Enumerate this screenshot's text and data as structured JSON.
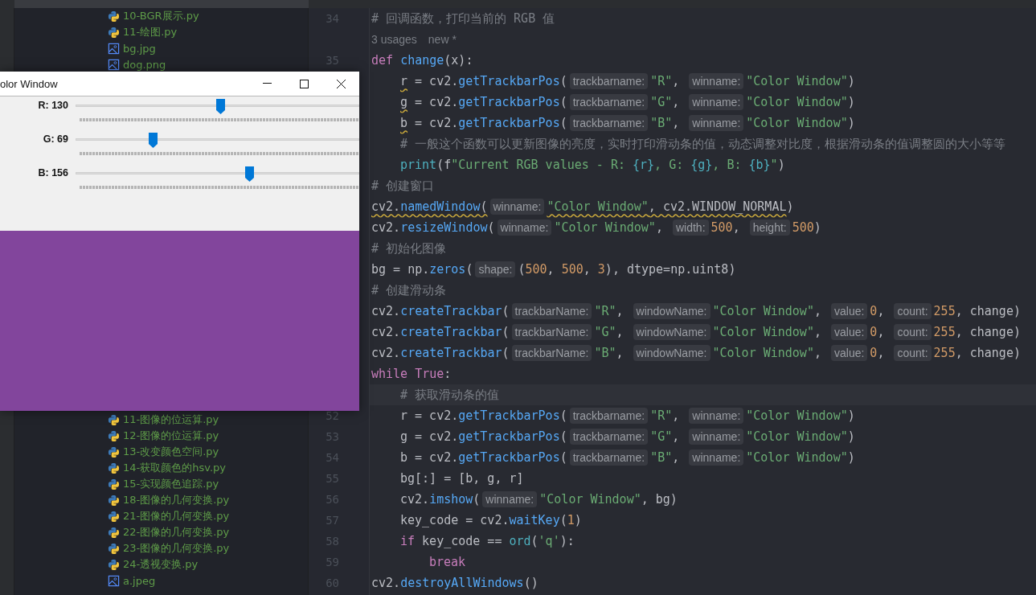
{
  "project_tree": {
    "top_items": [
      {
        "kind": "python",
        "name": "10-BGR展示.py"
      },
      {
        "kind": "python",
        "name": "11-绘图.py"
      },
      {
        "kind": "image",
        "name": "bg.jpg"
      },
      {
        "kind": "image",
        "name": "dog.png"
      }
    ],
    "bottom_items": [
      {
        "kind": "python",
        "name": "11-图像的位运算.py"
      },
      {
        "kind": "python",
        "name": "12-图像的位运算.py"
      },
      {
        "kind": "python",
        "name": "13-改变颜色空间.py"
      },
      {
        "kind": "python",
        "name": "14-获取颜色的hsv.py"
      },
      {
        "kind": "python",
        "name": "15-实现颜色追踪.py"
      },
      {
        "kind": "python",
        "name": "18-图像的几何变换.py"
      },
      {
        "kind": "python",
        "name": "21-图像的几何变换.py"
      },
      {
        "kind": "python",
        "name": "22-图像的几何变换.py"
      },
      {
        "kind": "python",
        "name": "23-图像的几何变换.py"
      },
      {
        "kind": "python",
        "name": "24-透视变换.py"
      },
      {
        "kind": "image",
        "name": "a.jpeg"
      }
    ]
  },
  "editor": {
    "lines": [
      {
        "number": "34",
        "tokens": [
          {
            "kind": "comment",
            "text": "# 回调函数，打印当前的 RGB 值"
          }
        ]
      },
      {
        "kind": "usages",
        "texts": [
          "3 usages",
          "new *"
        ]
      },
      {
        "number": "35",
        "tokens": [
          {
            "kind": "keyword",
            "text": "def "
          },
          {
            "kind": "function",
            "text": "change"
          },
          {
            "kind": "plain",
            "text": "(x):"
          }
        ],
        "children": [
          {
            "tokens": [
              {
                "kind": "plain",
                "text": "r",
                "warning": true
              },
              {
                "kind": "plain",
                "text": " = cv2."
              },
              {
                "kind": "function",
                "text": "getTrackbarPos"
              },
              {
                "kind": "plain",
                "text": "("
              },
              {
                "kind": "hint",
                "text": "trackbarname:"
              },
              {
                "kind": "string",
                "text": "\"R\""
              },
              {
                "kind": "plain",
                "text": ", "
              },
              {
                "kind": "hint",
                "text": "winname:"
              },
              {
                "kind": "string",
                "text": "\"Color Window\""
              },
              {
                "kind": "plain",
                "text": ")"
              }
            ]
          },
          {
            "tokens": [
              {
                "kind": "plain",
                "text": "g",
                "warning": true
              },
              {
                "kind": "plain",
                "text": " = cv2."
              },
              {
                "kind": "function",
                "text": "getTrackbarPos"
              },
              {
                "kind": "plain",
                "text": "("
              },
              {
                "kind": "hint",
                "text": "trackbarname:"
              },
              {
                "kind": "string",
                "text": "\"G\""
              },
              {
                "kind": "plain",
                "text": ", "
              },
              {
                "kind": "hint",
                "text": "winname:"
              },
              {
                "kind": "string",
                "text": "\"Color Window\""
              },
              {
                "kind": "plain",
                "text": ")"
              }
            ]
          },
          {
            "tokens": [
              {
                "kind": "plain",
                "text": "b",
                "warning": true
              },
              {
                "kind": "plain",
                "text": " = cv2."
              },
              {
                "kind": "function",
                "text": "getTrackbarPos"
              },
              {
                "kind": "plain",
                "text": "("
              },
              {
                "kind": "hint",
                "text": "trackbarname:"
              },
              {
                "kind": "string",
                "text": "\"B\""
              },
              {
                "kind": "plain",
                "text": ", "
              },
              {
                "kind": "hint",
                "text": "winname:"
              },
              {
                "kind": "string",
                "text": "\"Color Window\""
              },
              {
                "kind": "plain",
                "text": ")"
              }
            ]
          },
          {
            "tokens": [
              {
                "kind": "comment",
                "text": "# 一般这个函数可以更新图像的亮度，实时打印滑动条的值，动态调整对比度，根据滑动条的值调整圆的大小等等"
              }
            ]
          },
          {
            "tokens": [
              {
                "kind": "builtin",
                "text": "print"
              },
              {
                "kind": "plain",
                "text": "(f"
              },
              {
                "kind": "string",
                "text": "\"Current RGB values - R: "
              },
              {
                "kind": "builtin",
                "text": "{r}"
              },
              {
                "kind": "string",
                "text": ", G: "
              },
              {
                "kind": "builtin",
                "text": "{g}"
              },
              {
                "kind": "string",
                "text": ", B: "
              },
              {
                "kind": "builtin",
                "text": "{b}"
              },
              {
                "kind": "string",
                "text": "\""
              },
              {
                "kind": "plain",
                "text": ")"
              }
            ]
          }
        ]
      },
      {
        "tokens": [
          {
            "kind": "comment",
            "text": "# 创建窗口"
          }
        ]
      },
      {
        "tokens": [
          {
            "kind": "plain",
            "text": "cv2.",
            "warning": true
          },
          {
            "kind": "function",
            "text": "namedWindow",
            "warning": true
          },
          {
            "kind": "plain",
            "text": "(",
            "warning": true
          },
          {
            "kind": "hint",
            "text": "winname:"
          },
          {
            "kind": "string",
            "text": "\"Color Window\"",
            "warning": true
          },
          {
            "kind": "plain",
            "text": ", cv2.WINDOW_NORMAL",
            "warning": true
          },
          {
            "kind": "plain",
            "text": ")"
          }
        ]
      },
      {
        "tokens": [
          {
            "kind": "plain",
            "text": "cv2."
          },
          {
            "kind": "function",
            "text": "resizeWindow"
          },
          {
            "kind": "plain",
            "text": "("
          },
          {
            "kind": "hint",
            "text": "winname:"
          },
          {
            "kind": "string",
            "text": "\"Color Window\""
          },
          {
            "kind": "plain",
            "text": ", "
          },
          {
            "kind": "hint",
            "text": "width:"
          },
          {
            "kind": "number",
            "text": "500"
          },
          {
            "kind": "plain",
            "text": ", "
          },
          {
            "kind": "hint",
            "text": "height:"
          },
          {
            "kind": "number",
            "text": "500"
          },
          {
            "kind": "plain",
            "text": ")"
          }
        ]
      },
      {
        "tokens": [
          {
            "kind": "comment",
            "text": "# 初始化图像"
          }
        ]
      },
      {
        "tokens": [
          {
            "kind": "plain",
            "text": "bg = np."
          },
          {
            "kind": "function",
            "text": "zeros"
          },
          {
            "kind": "plain",
            "text": "("
          },
          {
            "kind": "hint",
            "text": "shape:"
          },
          {
            "kind": "plain",
            "text": "("
          },
          {
            "kind": "number",
            "text": "500"
          },
          {
            "kind": "plain",
            "text": ", "
          },
          {
            "kind": "number",
            "text": "500"
          },
          {
            "kind": "plain",
            "text": ", "
          },
          {
            "kind": "number",
            "text": "3"
          },
          {
            "kind": "plain",
            "text": "), dtype=np.uint8)"
          }
        ]
      },
      {
        "tokens": [
          {
            "kind": "comment",
            "text": "# 创建滑动条"
          }
        ]
      },
      {
        "tokens": [
          {
            "kind": "plain",
            "text": "cv2."
          },
          {
            "kind": "function",
            "text": "createTrackbar"
          },
          {
            "kind": "plain",
            "text": "("
          },
          {
            "kind": "hint",
            "text": "trackbarName:"
          },
          {
            "kind": "string",
            "text": "\"R\""
          },
          {
            "kind": "plain",
            "text": ", "
          },
          {
            "kind": "hint",
            "text": "windowName:"
          },
          {
            "kind": "string",
            "text": "\"Color Window\""
          },
          {
            "kind": "plain",
            "text": ", "
          },
          {
            "kind": "hint",
            "text": "value:"
          },
          {
            "kind": "number",
            "text": "0"
          },
          {
            "kind": "plain",
            "text": ", "
          },
          {
            "kind": "hint",
            "text": "count:"
          },
          {
            "kind": "number",
            "text": "255"
          },
          {
            "kind": "plain",
            "text": ", change)"
          }
        ]
      },
      {
        "tokens": [
          {
            "kind": "plain",
            "text": "cv2."
          },
          {
            "kind": "function",
            "text": "createTrackbar"
          },
          {
            "kind": "plain",
            "text": "("
          },
          {
            "kind": "hint",
            "text": "trackbarName:"
          },
          {
            "kind": "string",
            "text": "\"G\""
          },
          {
            "kind": "plain",
            "text": ", "
          },
          {
            "kind": "hint",
            "text": "windowName:"
          },
          {
            "kind": "string",
            "text": "\"Color Window\""
          },
          {
            "kind": "plain",
            "text": ", "
          },
          {
            "kind": "hint",
            "text": "value:"
          },
          {
            "kind": "number",
            "text": "0"
          },
          {
            "kind": "plain",
            "text": ", "
          },
          {
            "kind": "hint",
            "text": "count:"
          },
          {
            "kind": "number",
            "text": "255"
          },
          {
            "kind": "plain",
            "text": ", change)"
          }
        ]
      },
      {
        "tokens": [
          {
            "kind": "plain",
            "text": "cv2."
          },
          {
            "kind": "function",
            "text": "createTrackbar"
          },
          {
            "kind": "plain",
            "text": "("
          },
          {
            "kind": "hint",
            "text": "trackbarName:"
          },
          {
            "kind": "string",
            "text": "\"B\""
          },
          {
            "kind": "plain",
            "text": ", "
          },
          {
            "kind": "hint",
            "text": "windowName:"
          },
          {
            "kind": "string",
            "text": "\"Color Window\""
          },
          {
            "kind": "plain",
            "text": ", "
          },
          {
            "kind": "hint",
            "text": "value:"
          },
          {
            "kind": "number",
            "text": "0"
          },
          {
            "kind": "plain",
            "text": ", "
          },
          {
            "kind": "hint",
            "text": "count:"
          },
          {
            "kind": "number",
            "text": "255"
          },
          {
            "kind": "plain",
            "text": ", change)"
          }
        ]
      },
      {
        "tokens": [
          {
            "kind": "keyword",
            "text": "while "
          },
          {
            "kind": "keyword",
            "text": "True"
          },
          {
            "kind": "plain",
            "text": ":"
          }
        ],
        "children": [
          {
            "current": true,
            "tokens": [
              {
                "kind": "comment",
                "text": "# 获取滑动条的值"
              }
            ]
          },
          {
            "number": "52",
            "tokens": [
              {
                "kind": "plain",
                "text": "r = cv2."
              },
              {
                "kind": "function",
                "text": "getTrackbarPos"
              },
              {
                "kind": "plain",
                "text": "("
              },
              {
                "kind": "hint",
                "text": "trackbarname:"
              },
              {
                "kind": "string",
                "text": "\"R\""
              },
              {
                "kind": "plain",
                "text": ", "
              },
              {
                "kind": "hint",
                "text": "winname:"
              },
              {
                "kind": "string",
                "text": "\"Color Window\""
              },
              {
                "kind": "plain",
                "text": ")"
              }
            ]
          },
          {
            "number": "53",
            "tokens": [
              {
                "kind": "plain",
                "text": "g = cv2."
              },
              {
                "kind": "function",
                "text": "getTrackbarPos"
              },
              {
                "kind": "plain",
                "text": "("
              },
              {
                "kind": "hint",
                "text": "trackbarname:"
              },
              {
                "kind": "string",
                "text": "\"G\""
              },
              {
                "kind": "plain",
                "text": ", "
              },
              {
                "kind": "hint",
                "text": "winname:"
              },
              {
                "kind": "string",
                "text": "\"Color Window\""
              },
              {
                "kind": "plain",
                "text": ")"
              }
            ]
          },
          {
            "number": "54",
            "tokens": [
              {
                "kind": "plain",
                "text": "b = cv2."
              },
              {
                "kind": "function",
                "text": "getTrackbarPos"
              },
              {
                "kind": "plain",
                "text": "("
              },
              {
                "kind": "hint",
                "text": "trackbarname:"
              },
              {
                "kind": "string",
                "text": "\"B\""
              },
              {
                "kind": "plain",
                "text": ", "
              },
              {
                "kind": "hint",
                "text": "winname:"
              },
              {
                "kind": "string",
                "text": "\"Color Window\""
              },
              {
                "kind": "plain",
                "text": ")"
              }
            ]
          },
          {
            "number": "55",
            "tokens": [
              {
                "kind": "plain",
                "text": "bg[:] = [b, g, r]"
              }
            ]
          },
          {
            "number": "56",
            "tokens": [
              {
                "kind": "plain",
                "text": "cv2."
              },
              {
                "kind": "function",
                "text": "imshow"
              },
              {
                "kind": "plain",
                "text": "("
              },
              {
                "kind": "hint",
                "text": "winname:"
              },
              {
                "kind": "string",
                "text": "\"Color Window\""
              },
              {
                "kind": "plain",
                "text": ", bg)"
              }
            ]
          },
          {
            "number": "57",
            "tokens": [
              {
                "kind": "plain",
                "text": "key_code = cv2."
              },
              {
                "kind": "function",
                "text": "waitKey"
              },
              {
                "kind": "plain",
                "text": "("
              },
              {
                "kind": "number",
                "text": "1"
              },
              {
                "kind": "plain",
                "text": ")"
              }
            ]
          },
          {
            "number": "58",
            "tokens": [
              {
                "kind": "keyword",
                "text": "if"
              },
              {
                "kind": "plain",
                "text": " key_code == "
              },
              {
                "kind": "builtin",
                "text": "ord"
              },
              {
                "kind": "plain",
                "text": "("
              },
              {
                "kind": "string",
                "text": "'q'"
              },
              {
                "kind": "plain",
                "text": "):"
              }
            ],
            "children": [
              {
                "number": "59",
                "tokens": [
                  {
                    "kind": "keyword",
                    "text": "break"
                  }
                ]
              }
            ]
          }
        ]
      },
      {
        "number": "60",
        "tokens": [
          {
            "kind": "plain",
            "text": "cv2."
          },
          {
            "kind": "function",
            "text": "destroyAllWindows"
          },
          {
            "kind": "plain",
            "text": "()"
          }
        ]
      }
    ]
  },
  "preview_window": {
    "title": "olor Window",
    "trackbars": [
      {
        "label": "R: 130",
        "level": 0.5098
      },
      {
        "label": "G: 69",
        "level": 0.2706
      },
      {
        "label": "B: 156",
        "level": 0.6118
      }
    ]
  }
}
